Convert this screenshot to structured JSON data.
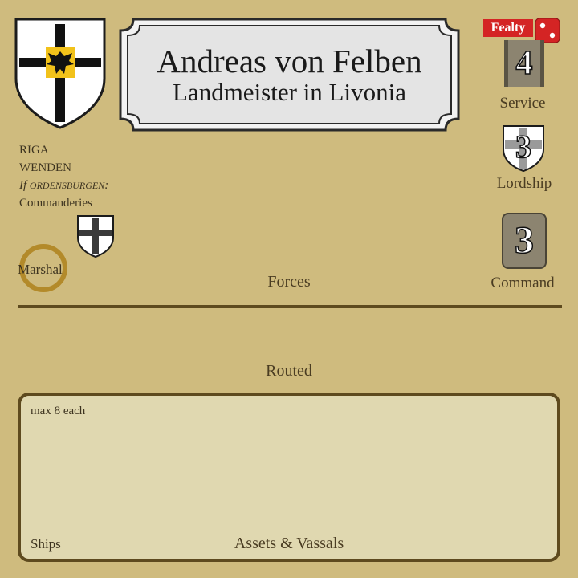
{
  "lord": {
    "name": "Andreas von Felben",
    "title": "Landmeister in Livonia"
  },
  "seats": {
    "line1": "RIGA",
    "line2": "WENDEN",
    "condition_prefix": "If ",
    "condition_caps": "Ordensburgen",
    "condition_suffix": ":",
    "line4": "Commanderies"
  },
  "marshal": {
    "label": "Marshal"
  },
  "forces": {
    "label": "Forces"
  },
  "routed": {
    "label": "Routed"
  },
  "assets": {
    "note": "max 8 each",
    "ships_label": "Ships",
    "label": "Assets & Vassals"
  },
  "fealty": {
    "label": "Fealty"
  },
  "service": {
    "value": "4",
    "label": "Service"
  },
  "lordship": {
    "value": "3",
    "label": "Lordship"
  },
  "command": {
    "value": "3",
    "label": "Command"
  },
  "icons": {
    "coat_of_arms": "teutonic-cross-eagle-shield",
    "commandery": "black-cross-shield",
    "die": "die-two",
    "lordship": "gray-cross-shield"
  },
  "colors": {
    "mat": "#cfbb7e",
    "fealty": "#d42424",
    "marshal_ring": "#b38a2a",
    "rule": "#5e4a1e"
  }
}
